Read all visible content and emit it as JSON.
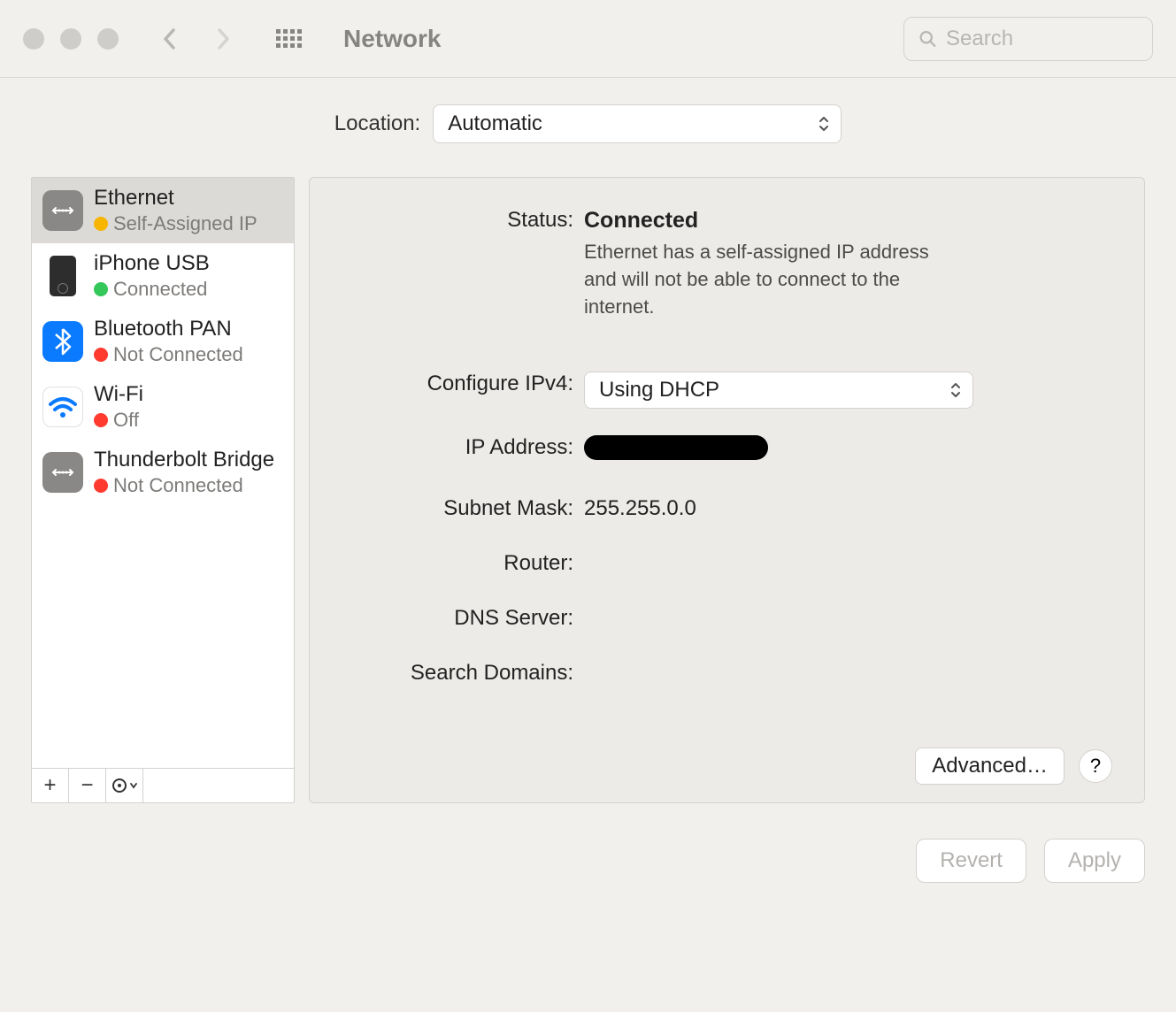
{
  "titlebar": {
    "title": "Network",
    "search_placeholder": "Search"
  },
  "location": {
    "label": "Location:",
    "value": "Automatic"
  },
  "sidebar": {
    "items": [
      {
        "name": "Ethernet",
        "status": "Self-Assigned IP",
        "color": "yellow",
        "icon": "ethernet",
        "selected": true
      },
      {
        "name": "iPhone USB",
        "status": "Connected",
        "color": "green",
        "icon": "iphone",
        "selected": false
      },
      {
        "name": "Bluetooth PAN",
        "status": "Not Connected",
        "color": "red",
        "icon": "bluetooth",
        "selected": false
      },
      {
        "name": "Wi-Fi",
        "status": "Off",
        "color": "red",
        "icon": "wifi",
        "selected": false
      },
      {
        "name": "Thunderbolt Bridge",
        "status": "Not Connected",
        "color": "red",
        "icon": "ethernet",
        "selected": false
      }
    ]
  },
  "detail": {
    "status_label": "Status:",
    "status_value": "Connected",
    "status_description": "Ethernet has a self-assigned IP address and will not be able to connect to the internet.",
    "configure_label": "Configure IPv4:",
    "configure_value": "Using DHCP",
    "ip_label": "IP Address:",
    "ip_value": "",
    "subnet_label": "Subnet Mask:",
    "subnet_value": "255.255.0.0",
    "router_label": "Router:",
    "router_value": "",
    "dns_label": "DNS Server:",
    "dns_value": "",
    "search_domains_label": "Search Domains:",
    "search_domains_value": "",
    "advanced_button": "Advanced…",
    "help_button": "?"
  },
  "bottom": {
    "revert": "Revert",
    "apply": "Apply"
  }
}
